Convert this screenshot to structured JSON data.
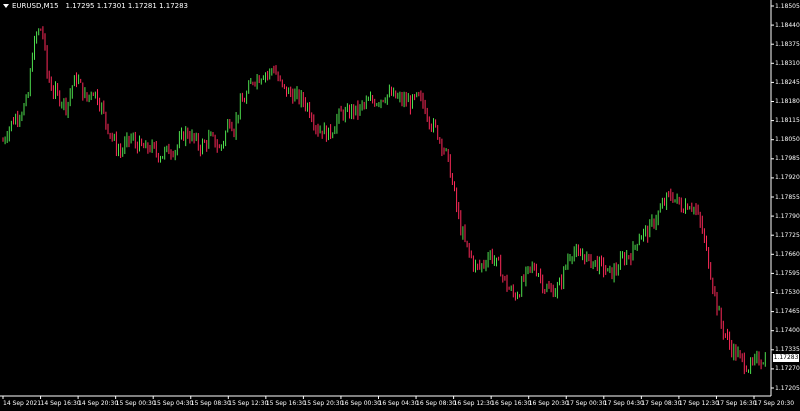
{
  "window": {
    "symbol_label": "EURUSD,M15",
    "ohlc_label": "1.17295 1.17301 1.17281 1.17283",
    "menu_icon": "triangle-down-icon"
  },
  "colors": {
    "background": "#000000",
    "bull": "#4ee04e",
    "bear": "#ff2a5a",
    "axis": "#ffffff"
  },
  "chart_data": {
    "type": "candlestick",
    "symbol": "EURUSD",
    "timeframe": "M15",
    "current_price": "1.17283",
    "ylim": [
      1.172,
      1.1851
    ],
    "y_ticks": [
      "1.18505",
      "1.18440",
      "1.18375",
      "1.18310",
      "1.18245",
      "1.18180",
      "1.18115",
      "1.18050",
      "1.17985",
      "1.17920",
      "1.17855",
      "1.17790",
      "1.17725",
      "1.17660",
      "1.17595",
      "1.17530",
      "1.17465",
      "1.17400",
      "1.17335",
      "1.17270",
      "1.17205"
    ],
    "x_ticks": [
      "14 Sep 2021",
      "14 Sep 16:30",
      "14 Sep 20:30",
      "15 Sep 00:30",
      "15 Sep 04:30",
      "15 Sep 08:30",
      "15 Sep 12:30",
      "15 Sep 16:30",
      "15 Sep 20:30",
      "16 Sep 00:30",
      "16 Sep 04:30",
      "16 Sep 08:30",
      "16 Sep 12:30",
      "16 Sep 16:30",
      "16 Sep 20:30",
      "17 Sep 00:30",
      "17 Sep 04:30",
      "17 Sep 08:30",
      "17 Sep 12:30",
      "17 Sep 16:30",
      "17 Sep 20:30"
    ],
    "close_path": [
      1.1804,
      1.1808,
      1.1811,
      1.1813,
      1.1815,
      1.1818,
      1.1835,
      1.1842,
      1.1843,
      1.1827,
      1.1822,
      1.182,
      1.1818,
      1.1816,
      1.1823,
      1.1826,
      1.1822,
      1.1818,
      1.1822,
      1.182,
      1.1816,
      1.181,
      1.1806,
      1.1802,
      1.18,
      1.1803,
      1.1805,
      1.1803,
      1.1802,
      1.1801,
      1.1802,
      1.18,
      1.1799,
      1.18,
      1.1801,
      1.1801,
      1.1804,
      1.1807,
      1.1806,
      1.1804,
      1.1802,
      1.1803,
      1.1805,
      1.1804,
      1.1801,
      1.1805,
      1.1812,
      1.1808,
      1.1816,
      1.1818,
      1.1822,
      1.1826,
      1.1826,
      1.1828,
      1.1827,
      1.183,
      1.1825,
      1.1822,
      1.1821,
      1.182,
      1.1819,
      1.1818,
      1.1816,
      1.1812,
      1.1808,
      1.1808,
      1.1806,
      1.1808,
      1.1812,
      1.1814,
      1.1813,
      1.1815,
      1.1814,
      1.1816,
      1.1817,
      1.1818,
      1.1818,
      1.1819,
      1.182,
      1.182,
      1.1819,
      1.1818,
      1.1818,
      1.1817,
      1.1819,
      1.1818,
      1.1815,
      1.181,
      1.1808,
      1.1804,
      1.18,
      1.1793,
      1.1783,
      1.1774,
      1.1768,
      1.1764,
      1.176,
      1.176,
      1.1762,
      1.1765,
      1.1762,
      1.176,
      1.1755,
      1.1752,
      1.175,
      1.1752,
      1.1756,
      1.1759,
      1.176,
      1.1758,
      1.1753,
      1.1752,
      1.1752,
      1.1753,
      1.1758,
      1.1764,
      1.1766,
      1.1763,
      1.1765,
      1.1762,
      1.1762,
      1.1761,
      1.176,
      1.1758,
      1.1758,
      1.176,
      1.1763,
      1.1764,
      1.1765,
      1.177,
      1.1772,
      1.1772,
      1.1775,
      1.1778,
      1.1781,
      1.1784,
      1.1785,
      1.1783,
      1.1781,
      1.1782,
      1.1782,
      1.1779,
      1.1774,
      1.1766,
      1.1757,
      1.1748,
      1.174,
      1.1736,
      1.1732,
      1.173,
      1.1728,
      1.1726,
      1.1725,
      1.1727,
      1.1728,
      1.1728
    ]
  }
}
